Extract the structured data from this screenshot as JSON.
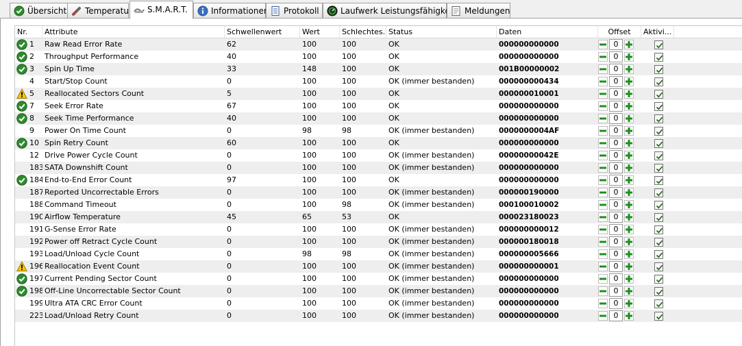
{
  "tabs": [
    {
      "label": "Übersicht",
      "icon": "check-circle-icon"
    },
    {
      "label": "Temperatur",
      "icon": "thermometer-icon"
    },
    {
      "label": "S.M.A.R.T.",
      "icon": "smart-icon"
    },
    {
      "label": "Informationen",
      "icon": "info-icon"
    },
    {
      "label": "Protokoll",
      "icon": "document-icon"
    },
    {
      "label": "Laufwerk Leistungsfähigkeit",
      "icon": "gauge-icon"
    },
    {
      "label": "Meldungen",
      "icon": "message-icon"
    }
  ],
  "active_tab": "S.M.A.R.T.",
  "columns": {
    "nr": "Nr.",
    "attribute": "Attribute",
    "threshold": "Schwellenwert",
    "value": "Wert",
    "worst": "Schlechtes...",
    "status": "Status",
    "data": "Daten",
    "offset": "Offset",
    "active": "Aktivi..."
  },
  "rows": [
    {
      "nr": "1",
      "attribute": "Raw Read Error Rate",
      "threshold": "62",
      "value": "100",
      "worst": "100",
      "status": "OK",
      "data": "000000000000",
      "offset": "0",
      "icon": "ok",
      "active": true
    },
    {
      "nr": "2",
      "attribute": "Throughput Performance",
      "threshold": "40",
      "value": "100",
      "worst": "100",
      "status": "OK",
      "data": "000000000000",
      "offset": "0",
      "icon": "ok",
      "active": true
    },
    {
      "nr": "3",
      "attribute": "Spin Up Time",
      "threshold": "33",
      "value": "148",
      "worst": "100",
      "status": "OK",
      "data": "001B00000002",
      "offset": "0",
      "icon": "ok",
      "active": true
    },
    {
      "nr": "4",
      "attribute": "Start/Stop Count",
      "threshold": "0",
      "value": "100",
      "worst": "100",
      "status": "OK (immer bestanden)",
      "data": "000000000434",
      "offset": "0",
      "icon": "none",
      "active": true
    },
    {
      "nr": "5",
      "attribute": "Reallocated Sectors Count",
      "threshold": "5",
      "value": "100",
      "worst": "100",
      "status": "OK",
      "data": "000000010001",
      "offset": "0",
      "icon": "warn",
      "active": true
    },
    {
      "nr": "7",
      "attribute": "Seek Error Rate",
      "threshold": "67",
      "value": "100",
      "worst": "100",
      "status": "OK",
      "data": "000000000000",
      "offset": "0",
      "icon": "ok",
      "active": true
    },
    {
      "nr": "8",
      "attribute": "Seek Time Performance",
      "threshold": "40",
      "value": "100",
      "worst": "100",
      "status": "OK",
      "data": "000000000000",
      "offset": "0",
      "icon": "ok",
      "active": true
    },
    {
      "nr": "9",
      "attribute": "Power On Time Count",
      "threshold": "0",
      "value": "98",
      "worst": "98",
      "status": "OK (immer bestanden)",
      "data": "0000000004AF",
      "offset": "0",
      "icon": "none",
      "active": true
    },
    {
      "nr": "10",
      "attribute": "Spin Retry Count",
      "threshold": "60",
      "value": "100",
      "worst": "100",
      "status": "OK",
      "data": "000000000000",
      "offset": "0",
      "icon": "ok",
      "active": true
    },
    {
      "nr": "12",
      "attribute": "Drive Power Cycle Count",
      "threshold": "0",
      "value": "100",
      "worst": "100",
      "status": "OK (immer bestanden)",
      "data": "00000000042E",
      "offset": "0",
      "icon": "none",
      "active": true
    },
    {
      "nr": "183",
      "attribute": "SATA Downshift Count",
      "threshold": "0",
      "value": "100",
      "worst": "100",
      "status": "OK (immer bestanden)",
      "data": "000000000000",
      "offset": "0",
      "icon": "none",
      "active": true
    },
    {
      "nr": "184",
      "attribute": "End-to-End Error Count",
      "threshold": "97",
      "value": "100",
      "worst": "100",
      "status": "OK",
      "data": "000000000000",
      "offset": "0",
      "icon": "ok",
      "active": true
    },
    {
      "nr": "187",
      "attribute": "Reported Uncorrectable Errors",
      "threshold": "0",
      "value": "100",
      "worst": "100",
      "status": "OK (immer bestanden)",
      "data": "000000190000",
      "offset": "0",
      "icon": "none",
      "active": true
    },
    {
      "nr": "188",
      "attribute": "Command Timeout",
      "threshold": "0",
      "value": "100",
      "worst": "98",
      "status": "OK (immer bestanden)",
      "data": "000100010002",
      "offset": "0",
      "icon": "none",
      "active": true
    },
    {
      "nr": "190",
      "attribute": "Airflow Temperature",
      "threshold": "45",
      "value": "65",
      "worst": "53",
      "status": "OK",
      "data": "000023180023",
      "offset": "0",
      "icon": "none",
      "active": true
    },
    {
      "nr": "191",
      "attribute": "G-Sense Error Rate",
      "threshold": "0",
      "value": "100",
      "worst": "100",
      "status": "OK (immer bestanden)",
      "data": "000000000012",
      "offset": "0",
      "icon": "none",
      "active": true
    },
    {
      "nr": "192",
      "attribute": "Power off Retract Cycle Count",
      "threshold": "0",
      "value": "100",
      "worst": "100",
      "status": "OK (immer bestanden)",
      "data": "000000180018",
      "offset": "0",
      "icon": "none",
      "active": true
    },
    {
      "nr": "193",
      "attribute": "Load/Unload Cycle Count",
      "threshold": "0",
      "value": "98",
      "worst": "98",
      "status": "OK (immer bestanden)",
      "data": "000000005666",
      "offset": "0",
      "icon": "none",
      "active": true
    },
    {
      "nr": "196",
      "attribute": "Reallocation Event Count",
      "threshold": "0",
      "value": "100",
      "worst": "100",
      "status": "OK (immer bestanden)",
      "data": "000000000001",
      "offset": "0",
      "icon": "warn",
      "active": true
    },
    {
      "nr": "197",
      "attribute": "Current Pending Sector Count",
      "threshold": "0",
      "value": "100",
      "worst": "100",
      "status": "OK (immer bestanden)",
      "data": "000000000000",
      "offset": "0",
      "icon": "ok",
      "active": true
    },
    {
      "nr": "198",
      "attribute": "Off-Line Uncorrectable Sector Count",
      "threshold": "0",
      "value": "100",
      "worst": "100",
      "status": "OK (immer bestanden)",
      "data": "000000000000",
      "offset": "0",
      "icon": "ok",
      "active": true
    },
    {
      "nr": "199",
      "attribute": "Ultra ATA CRC Error Count",
      "threshold": "0",
      "value": "100",
      "worst": "100",
      "status": "OK (immer bestanden)",
      "data": "000000000000",
      "offset": "0",
      "icon": "none",
      "active": true
    },
    {
      "nr": "223",
      "attribute": "Load/Unload Retry Count",
      "threshold": "0",
      "value": "100",
      "worst": "100",
      "status": "OK (immer bestanden)",
      "data": "000000000000",
      "offset": "0",
      "icon": "none",
      "active": true
    }
  ],
  "colors": {
    "ok_green": "#2e8b2e",
    "warn_yellow": "#f5c400",
    "row_alt": "#eeeeee",
    "offset_button_green": "#1e8f1e"
  }
}
